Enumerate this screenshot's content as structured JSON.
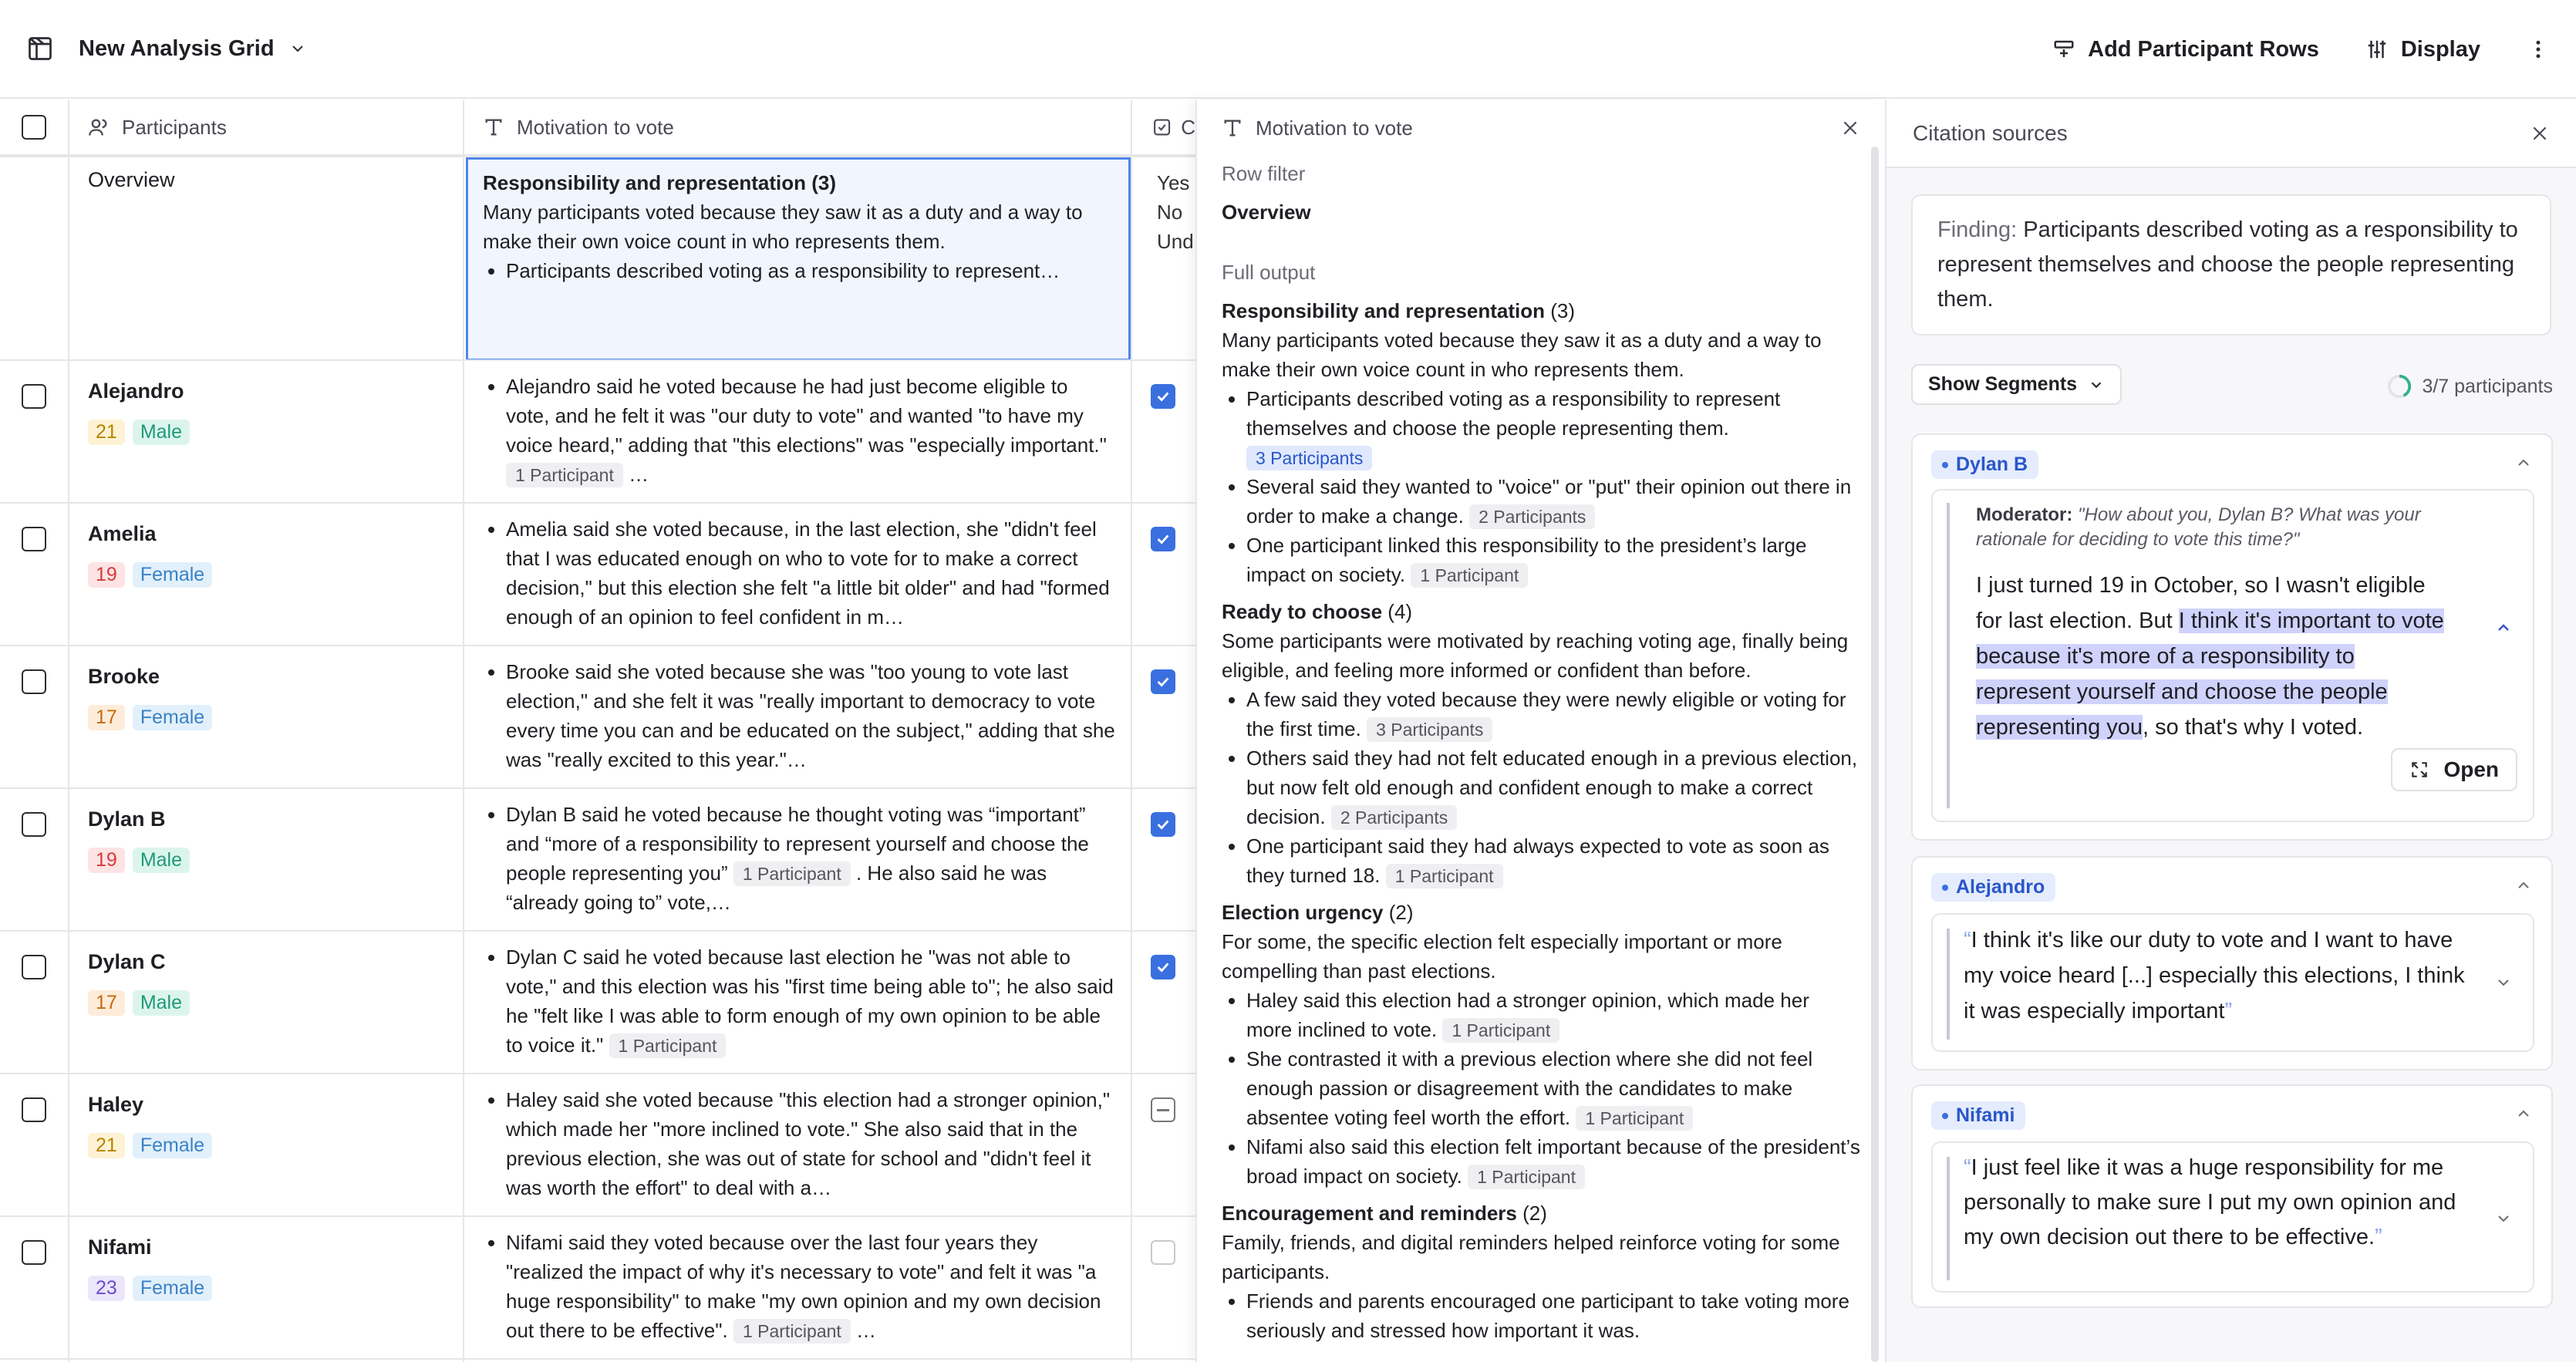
{
  "header": {
    "title": "New Analysis Grid",
    "add_rows_label": "Add Participant Rows",
    "display_label": "Display"
  },
  "grid": {
    "col_participants": "Participants",
    "col_motivation": "Motivation to vote",
    "col_third_partial": "C",
    "overview": {
      "label": "Overview",
      "title": "Responsibility and representation (3)",
      "text": "Many participants voted because they saw it as a duty and a way to make their own voice count in who represents them.",
      "bullet": "Participants described voting as a responsibility to represent…",
      "options": [
        "Yes",
        "No",
        "Und"
      ]
    },
    "rows": [
      {
        "name": "Alejandro",
        "age": "21",
        "gender": "Male",
        "text": "Alejandro said he voted because he had just become eligible to vote, and he felt it was \"our duty to vote\" and wanted \"to have my voice heard,\" adding that \"this elections\" was \"especially important.\"",
        "pill": "1 Participant",
        "tail": "…",
        "check": "checked"
      },
      {
        "name": "Amelia",
        "age": "19",
        "gender": "Female",
        "text": "Amelia said she voted because, in the last election, she \"didn't feel that I was educated enough on who to vote for to make a correct decision,\" but this election she felt \"a little bit older\" and had \"formed enough of an opinion to feel confident in m…",
        "pill": "",
        "tail": "",
        "check": "checked"
      },
      {
        "name": "Brooke",
        "age": "17",
        "gender": "Female",
        "text": "Brooke said she voted because she was \"too young to vote last election,\" and she felt it was \"really important to democracy to vote every time you can and be educated on the subject,\" adding that she was \"really excited to this year.\"…",
        "pill": "",
        "tail": "",
        "check": "checked"
      },
      {
        "name": "Dylan B",
        "age": "19",
        "gender": "Male",
        "text": "Dylan B said he voted because he thought voting was “important” and “more of a responsibility to represent yourself and choose the people representing you”",
        "pill": "1 Participant",
        "tail": ". He also said he was “already going to” vote,…",
        "check": "checked"
      },
      {
        "name": "Dylan C",
        "age": "17",
        "gender": "Male",
        "text": "Dylan C said he voted because last election he \"was not able to vote,\" and this election was his \"first time being able to\"; he also said he \"felt like I was able to form enough of my own opinion to be able to voice it.\"",
        "pill": "1 Participant",
        "tail": "",
        "check": "checked"
      },
      {
        "name": "Haley",
        "age": "21",
        "gender": "Female",
        "text": "Haley said she voted because \"this election had a stronger opinion,\" which made her \"more inclined to vote.\" She also said that in the previous election, she was out of state for school and \"didn't feel it was worth the effort\" to deal with a…",
        "pill": "",
        "tail": "",
        "check": "partial"
      },
      {
        "name": "Nifami",
        "age": "23",
        "gender": "Female",
        "text": "Nifami said they voted because over the last four years they \"realized the impact of why it's necessary to vote\" and felt it was \"a huge responsibility\" to make \"my own opinion and my own decision out there to be effective\".",
        "pill": "1 Participant",
        "tail": "…",
        "check": "empty"
      }
    ]
  },
  "mid_panel": {
    "title": "Motivation to vote",
    "row_filter_label": "Row filter",
    "row_filter_value": "Overview",
    "full_output_label": "Full output",
    "sections": [
      {
        "title": "Responsibility and representation",
        "count": "(3)",
        "text": "Many participants voted because they saw it as a duty and a way to make their own voice count in who represents them.",
        "bullets": [
          {
            "text": "Participants described voting as a responsibility to represent themselves and choose the people representing them.",
            "pill": "3 Participants",
            "active": true
          },
          {
            "text": "Several said they wanted to \"voice\" or \"put\" their opinion out there in order to make a change.",
            "pill": "2 Participants"
          },
          {
            "text": "One participant linked this responsibility to the president’s large impact on society.",
            "pill": "1 Participant"
          }
        ]
      },
      {
        "title": "Ready to choose",
        "count": "(4)",
        "text": "Some participants were motivated by reaching voting age, finally being eligible, and feeling more informed or confident than before.",
        "bullets": [
          {
            "text": "A few said they voted because they were newly eligible or voting for the first time.",
            "pill": "3 Participants"
          },
          {
            "text": "Others said they had not felt educated enough in a previous election, but now felt old enough and confident enough to make a correct decision.",
            "pill": "2 Participants"
          },
          {
            "text": "One participant said they had always expected to vote as soon as they turned 18.",
            "pill": "1 Participant"
          }
        ]
      },
      {
        "title": "Election urgency",
        "count": "(2)",
        "text": "For some, the specific election felt especially important or more compelling than past elections.",
        "bullets": [
          {
            "text": "Haley said this election had a stronger opinion, which made her more inclined to vote.",
            "pill": "1 Participant"
          },
          {
            "text": "She contrasted it with a previous election where she did not feel enough passion or disagreement with the candidates to make absentee voting feel worth the effort.",
            "pill": "1 Participant"
          },
          {
            "text": "Nifami also said this election felt important because of the president’s broad impact on society.",
            "pill": "1 Participant"
          }
        ]
      },
      {
        "title": "Encouragement and reminders",
        "count": "(2)",
        "text": "Family, friends, and digital reminders helped reinforce voting for some participants.",
        "bullets": [
          {
            "text": "Friends and parents encouraged one participant to take voting more seriously and stressed how important it was.",
            "pill": ""
          }
        ]
      }
    ]
  },
  "citations": {
    "title": "Citation sources",
    "finding_label": "Finding:",
    "finding_text": "Participants described voting as a responsibility to represent themselves and choose the people representing them.",
    "show_segments": "Show Segments",
    "progress": "3/7 participants",
    "cards": [
      {
        "name": "Dylan B",
        "moderator_label": "Moderator:",
        "moderator_text": "\"How about you, Dylan B? What was your rationale for deciding to vote this time?\"",
        "pre": "I just turned 19 in October, so I wasn't eligible for last election. But ",
        "highlight": "I think it's important to vote because it's more of a responsibility to represent yourself and choose the people representing you",
        "post": ", so that's why I voted.",
        "open_label": "Open"
      },
      {
        "name": "Alejandro",
        "quote": "I think it's like our duty to vote and I want to have my voice heard [...] especially this elections, I think it was especially important"
      },
      {
        "name": "Nifami",
        "quote": "I just feel like it was a huge responsibility for me personally to make sure I put my own opinion and my own decision out there to be effective."
      }
    ]
  },
  "colors": {
    "accent": "#3a6fe0",
    "highlight": "#cfd2fb",
    "male_text": "#1f9a7a",
    "female_text": "#3b82c4"
  }
}
